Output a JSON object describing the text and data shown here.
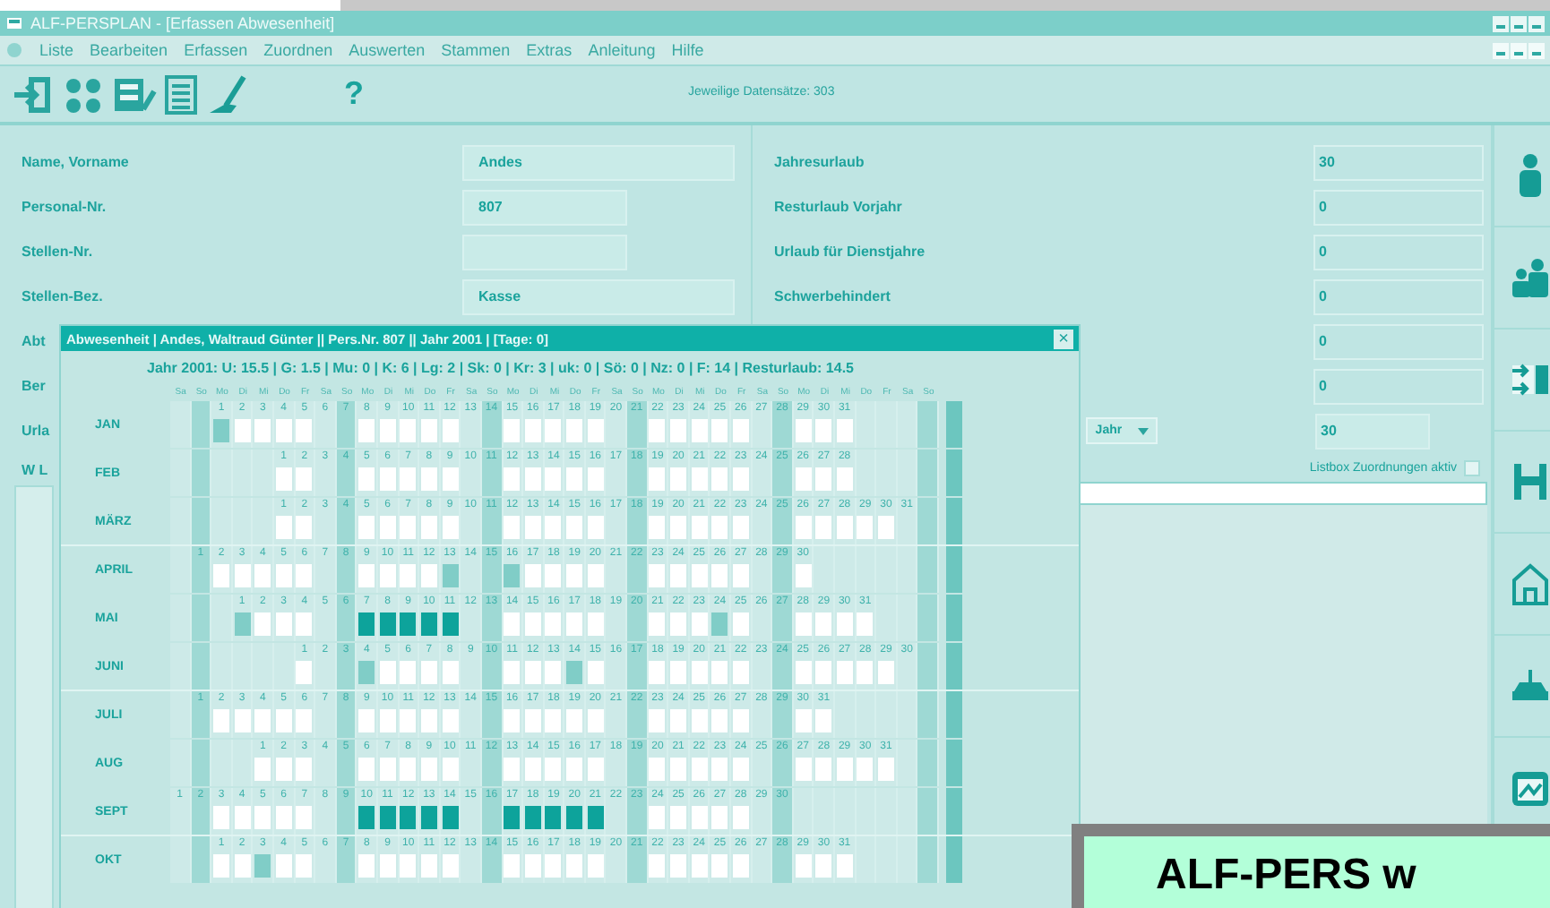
{
  "window": {
    "title": "ALF-PERSPLAN - [Erfassen Abwesenheit]"
  },
  "menu": [
    "Liste",
    "Bearbeiten",
    "Erfassen",
    "Zuordnen",
    "Auswerten",
    "Stammen",
    "Extras",
    "Anleitung",
    "Hilfe"
  ],
  "toolbar": {
    "help": "?",
    "record_count": "Jeweilige Datensätze: 303"
  },
  "person": [
    {
      "label": "Name, Vorname",
      "value": "Andes",
      "kind": "wide"
    },
    {
      "label": "Personal-Nr.",
      "value": "807",
      "kind": "narrow"
    },
    {
      "label": "Stellen-Nr.",
      "kind": "narrow"
    },
    {
      "label": "Stellen-Bez.",
      "value": "Kasse",
      "kind": "wide"
    },
    {
      "label": "Abt",
      "kind": "none"
    },
    {
      "label": "Ber",
      "kind": "none"
    },
    {
      "label": "Urla",
      "kind": "none"
    }
  ],
  "vacation": [
    {
      "label": "Jahresurlaub",
      "value": "30"
    },
    {
      "label": "Resturlaub Vorjahr",
      "value": "0"
    },
    {
      "label": "Urlaub für Dienstjahre",
      "value": "0"
    },
    {
      "label": "Schwerbehindert",
      "value": "0"
    },
    {
      "value": "0"
    },
    {
      "value": "0"
    }
  ],
  "year_select": {
    "value": "Jahr"
  },
  "year_value": "30",
  "listbox_toggle": {
    "label": "Listbox Zuordnungen aktiv",
    "checked": false
  },
  "left_list": {
    "header": "W L"
  },
  "dialog": {
    "title": "Abwesenheit | Andes, Waltraud Günter || Pers.Nr. 807 || Jahr 2001 | [Tage: 0]",
    "close": "×",
    "summary": "Jahr 2001: U: 15.5 | G: 1.5 | Mu: 0 | K: 6 | Lg: 2 | Sk: 0 | Kr: 3 | uk: 0 | Sö: 0 | Nz: 0 | F: 14 | Resturlaub: 14.5",
    "weekdays": [
      "Sa",
      "So",
      "Mo",
      "Di",
      "Mi",
      "Do",
      "Fr",
      "Sa",
      "So",
      "Mo",
      "Di",
      "Mi",
      "Do",
      "Fr",
      "Sa",
      "So",
      "Mo",
      "Di",
      "Mi",
      "Do",
      "Fr",
      "Sa",
      "So",
      "Mo",
      "Di",
      "Mi",
      "Do",
      "Fr",
      "Sa",
      "So",
      "Mo",
      "Di",
      "Mi",
      "Do",
      "Fr",
      "Sa",
      "So"
    ],
    "months": [
      {
        "label": "JAN",
        "cells": [
          {
            "kind": "blank"
          },
          {
            "kind": "blank"
          },
          {
            "day": "1",
            "kind": "holiday"
          },
          {
            "day": "2",
            "kind": "work"
          },
          {
            "day": "3",
            "kind": "work"
          },
          {
            "day": "4",
            "kind": "work"
          },
          {
            "day": "5",
            "kind": "work"
          },
          {
            "day": "6",
            "kind": "weekend"
          },
          {
            "day": "7",
            "kind": "weekend"
          },
          {
            "day": "8",
            "kind": "work"
          },
          {
            "day": "9",
            "kind": "work"
          },
          {
            "day": "10",
            "kind": "work"
          },
          {
            "day": "11",
            "kind": "work"
          },
          {
            "day": "12",
            "kind": "work"
          },
          {
            "day": "13",
            "kind": "weekend"
          },
          {
            "day": "14",
            "kind": "weekend"
          },
          {
            "day": "15",
            "kind": "work"
          },
          {
            "day": "16",
            "kind": "work"
          },
          {
            "day": "17",
            "kind": "work"
          },
          {
            "day": "18",
            "kind": "work"
          },
          {
            "day": "19",
            "kind": "work"
          },
          {
            "day": "20",
            "kind": "weekend"
          },
          {
            "day": "21",
            "kind": "weekend"
          },
          {
            "day": "22",
            "kind": "work"
          },
          {
            "day": "23",
            "kind": "work"
          },
          {
            "day": "24",
            "kind": "work"
          },
          {
            "day": "25",
            "kind": "work"
          },
          {
            "day": "26",
            "kind": "work"
          },
          {
            "day": "27",
            "kind": "weekend"
          },
          {
            "day": "28",
            "kind": "weekend"
          },
          {
            "day": "29",
            "kind": "work"
          },
          {
            "day": "30",
            "kind": "work"
          },
          {
            "day": "31",
            "kind": "work"
          }
        ]
      },
      {
        "label": "FEB",
        "cells": [
          {
            "kind": "blank"
          },
          {
            "kind": "blank"
          },
          {
            "kind": "blank"
          },
          {
            "kind": "blank"
          },
          {
            "kind": "blank"
          },
          {
            "day": "1",
            "kind": "work"
          },
          {
            "day": "2",
            "kind": "work"
          },
          {
            "day": "3",
            "kind": "weekend"
          },
          {
            "day": "4",
            "kind": "weekend"
          },
          {
            "day": "5",
            "kind": "work"
          },
          {
            "day": "6",
            "kind": "work"
          },
          {
            "day": "7",
            "kind": "work"
          },
          {
            "day": "8",
            "kind": "work"
          },
          {
            "day": "9",
            "kind": "work"
          },
          {
            "day": "10",
            "kind": "weekend"
          },
          {
            "day": "11",
            "kind": "weekend"
          },
          {
            "day": "12",
            "kind": "work"
          },
          {
            "day": "13",
            "kind": "work"
          },
          {
            "day": "14",
            "kind": "work"
          },
          {
            "day": "15",
            "kind": "work"
          },
          {
            "day": "16",
            "kind": "work"
          },
          {
            "day": "17",
            "kind": "weekend"
          },
          {
            "day": "18",
            "kind": "weekend"
          },
          {
            "day": "19",
            "kind": "work"
          },
          {
            "day": "20",
            "kind": "work"
          },
          {
            "day": "21",
            "kind": "work"
          },
          {
            "day": "22",
            "kind": "work"
          },
          {
            "day": "23",
            "kind": "work"
          },
          {
            "day": "24",
            "kind": "weekend"
          },
          {
            "day": "25",
            "kind": "weekend"
          },
          {
            "day": "26",
            "kind": "work"
          },
          {
            "day": "27",
            "kind": "work"
          },
          {
            "day": "28",
            "kind": "work"
          }
        ]
      },
      {
        "label": "MÄRZ",
        "cells": [
          {
            "kind": "blank"
          },
          {
            "kind": "blank"
          },
          {
            "kind": "blank"
          },
          {
            "kind": "blank"
          },
          {
            "kind": "blank"
          },
          {
            "day": "1",
            "kind": "work"
          },
          {
            "day": "2",
            "kind": "work"
          },
          {
            "day": "3",
            "kind": "weekend"
          },
          {
            "day": "4",
            "kind": "weekend"
          },
          {
            "day": "5",
            "kind": "work"
          },
          {
            "day": "6",
            "kind": "work"
          },
          {
            "day": "7",
            "kind": "work"
          },
          {
            "day": "8",
            "kind": "work"
          },
          {
            "day": "9",
            "kind": "work"
          },
          {
            "day": "10",
            "kind": "weekend"
          },
          {
            "day": "11",
            "kind": "weekend"
          },
          {
            "day": "12",
            "kind": "work"
          },
          {
            "day": "13",
            "kind": "work"
          },
          {
            "day": "14",
            "kind": "work"
          },
          {
            "day": "15",
            "kind": "work"
          },
          {
            "day": "16",
            "kind": "work"
          },
          {
            "day": "17",
            "kind": "weekend"
          },
          {
            "day": "18",
            "kind": "weekend"
          },
          {
            "day": "19",
            "kind": "work"
          },
          {
            "day": "20",
            "kind": "work"
          },
          {
            "day": "21",
            "kind": "work"
          },
          {
            "day": "22",
            "kind": "work"
          },
          {
            "day": "23",
            "kind": "work"
          },
          {
            "day": "24",
            "kind": "weekend"
          },
          {
            "day": "25",
            "kind": "weekend"
          },
          {
            "day": "26",
            "kind": "work"
          },
          {
            "day": "27",
            "kind": "work"
          },
          {
            "day": "28",
            "kind": "work"
          },
          {
            "day": "29",
            "kind": "work"
          },
          {
            "day": "30",
            "kind": "work"
          },
          {
            "day": "31",
            "kind": "weekend"
          }
        ]
      },
      {
        "label": "APRIL",
        "cells": [
          {
            "kind": "blank"
          },
          {
            "day": "1",
            "kind": "weekend"
          },
          {
            "day": "2",
            "kind": "work"
          },
          {
            "day": "3",
            "kind": "work"
          },
          {
            "day": "4",
            "kind": "work"
          },
          {
            "day": "5",
            "kind": "work"
          },
          {
            "day": "6",
            "kind": "work"
          },
          {
            "day": "7",
            "kind": "weekend"
          },
          {
            "day": "8",
            "kind": "weekend"
          },
          {
            "day": "9",
            "kind": "work"
          },
          {
            "day": "10",
            "kind": "work"
          },
          {
            "day": "11",
            "kind": "work"
          },
          {
            "day": "12",
            "kind": "work"
          },
          {
            "day": "13",
            "kind": "holiday"
          },
          {
            "day": "14",
            "kind": "weekend"
          },
          {
            "day": "15",
            "kind": "weekend"
          },
          {
            "day": "16",
            "kind": "holiday"
          },
          {
            "day": "17",
            "kind": "work"
          },
          {
            "day": "18",
            "kind": "work"
          },
          {
            "day": "19",
            "kind": "work"
          },
          {
            "day": "20",
            "kind": "work"
          },
          {
            "day": "21",
            "kind": "weekend"
          },
          {
            "day": "22",
            "kind": "weekend"
          },
          {
            "day": "23",
            "kind": "work"
          },
          {
            "day": "24",
            "kind": "work"
          },
          {
            "day": "25",
            "kind": "work"
          },
          {
            "day": "26",
            "kind": "work"
          },
          {
            "day": "27",
            "kind": "work"
          },
          {
            "day": "28",
            "kind": "weekend"
          },
          {
            "day": "29",
            "kind": "weekend"
          },
          {
            "day": "30",
            "kind": "work"
          }
        ]
      },
      {
        "label": "MAI",
        "cells": [
          {
            "kind": "blank"
          },
          {
            "kind": "blank"
          },
          {
            "kind": "blank"
          },
          {
            "day": "1",
            "kind": "holiday"
          },
          {
            "day": "2",
            "kind": "work"
          },
          {
            "day": "3",
            "kind": "work"
          },
          {
            "day": "4",
            "kind": "work"
          },
          {
            "day": "5",
            "kind": "weekend"
          },
          {
            "day": "6",
            "kind": "weekend"
          },
          {
            "day": "7",
            "kind": "absence"
          },
          {
            "day": "8",
            "kind": "absence"
          },
          {
            "day": "9",
            "kind": "absence"
          },
          {
            "day": "10",
            "kind": "absence"
          },
          {
            "day": "11",
            "kind": "absence"
          },
          {
            "day": "12",
            "kind": "weekend"
          },
          {
            "day": "13",
            "kind": "weekend"
          },
          {
            "day": "14",
            "kind": "work"
          },
          {
            "day": "15",
            "kind": "work"
          },
          {
            "day": "16",
            "kind": "work"
          },
          {
            "day": "17",
            "kind": "work"
          },
          {
            "day": "18",
            "kind": "work"
          },
          {
            "day": "19",
            "kind": "weekend"
          },
          {
            "day": "20",
            "kind": "weekend"
          },
          {
            "day": "21",
            "kind": "work"
          },
          {
            "day": "22",
            "kind": "work"
          },
          {
            "day": "23",
            "kind": "work"
          },
          {
            "day": "24",
            "kind": "holiday"
          },
          {
            "day": "25",
            "kind": "work"
          },
          {
            "day": "26",
            "kind": "weekend"
          },
          {
            "day": "27",
            "kind": "weekend"
          },
          {
            "day": "28",
            "kind": "work"
          },
          {
            "day": "29",
            "kind": "work"
          },
          {
            "day": "30",
            "kind": "work"
          },
          {
            "day": "31",
            "kind": "work"
          }
        ]
      },
      {
        "label": "JUNI",
        "cells": [
          {
            "kind": "blank"
          },
          {
            "kind": "blank"
          },
          {
            "kind": "blank"
          },
          {
            "kind": "blank"
          },
          {
            "kind": "blank"
          },
          {
            "kind": "blank"
          },
          {
            "day": "1",
            "kind": "work"
          },
          {
            "day": "2",
            "kind": "weekend"
          },
          {
            "day": "3",
            "kind": "weekend"
          },
          {
            "day": "4",
            "kind": "holiday"
          },
          {
            "day": "5",
            "kind": "work"
          },
          {
            "day": "6",
            "kind": "work"
          },
          {
            "day": "7",
            "kind": "work"
          },
          {
            "day": "8",
            "kind": "work"
          },
          {
            "day": "9",
            "kind": "weekend"
          },
          {
            "day": "10",
            "kind": "weekend"
          },
          {
            "day": "11",
            "kind": "work"
          },
          {
            "day": "12",
            "kind": "work"
          },
          {
            "day": "13",
            "kind": "work"
          },
          {
            "day": "14",
            "kind": "holiday"
          },
          {
            "day": "15",
            "kind": "work"
          },
          {
            "day": "16",
            "kind": "weekend"
          },
          {
            "day": "17",
            "kind": "weekend"
          },
          {
            "day": "18",
            "kind": "work"
          },
          {
            "day": "19",
            "kind": "work"
          },
          {
            "day": "20",
            "kind": "work"
          },
          {
            "day": "21",
            "kind": "work"
          },
          {
            "day": "22",
            "kind": "work"
          },
          {
            "day": "23",
            "kind": "weekend"
          },
          {
            "day": "24",
            "kind": "weekend"
          },
          {
            "day": "25",
            "kind": "work"
          },
          {
            "day": "26",
            "kind": "work"
          },
          {
            "day": "27",
            "kind": "work"
          },
          {
            "day": "28",
            "kind": "work"
          },
          {
            "day": "29",
            "kind": "work"
          },
          {
            "day": "30",
            "kind": "weekend"
          }
        ]
      },
      {
        "label": "JULI",
        "cells": [
          {
            "kind": "blank"
          },
          {
            "day": "1",
            "kind": "weekend"
          },
          {
            "day": "2",
            "kind": "work"
          },
          {
            "day": "3",
            "kind": "work"
          },
          {
            "day": "4",
            "kind": "work"
          },
          {
            "day": "5",
            "kind": "work"
          },
          {
            "day": "6",
            "kind": "work"
          },
          {
            "day": "7",
            "kind": "weekend"
          },
          {
            "day": "8",
            "kind": "weekend"
          },
          {
            "day": "9",
            "kind": "work"
          },
          {
            "day": "10",
            "kind": "work"
          },
          {
            "day": "11",
            "kind": "work"
          },
          {
            "day": "12",
            "kind": "work"
          },
          {
            "day": "13",
            "kind": "work"
          },
          {
            "day": "14",
            "kind": "weekend"
          },
          {
            "day": "15",
            "kind": "weekend"
          },
          {
            "day": "16",
            "kind": "work"
          },
          {
            "day": "17",
            "kind": "work"
          },
          {
            "day": "18",
            "kind": "work"
          },
          {
            "day": "19",
            "kind": "work"
          },
          {
            "day": "20",
            "kind": "work"
          },
          {
            "day": "21",
            "kind": "weekend"
          },
          {
            "day": "22",
            "kind": "weekend"
          },
          {
            "day": "23",
            "kind": "work"
          },
          {
            "day": "24",
            "kind": "work"
          },
          {
            "day": "25",
            "kind": "work"
          },
          {
            "day": "26",
            "kind": "work"
          },
          {
            "day": "27",
            "kind": "work"
          },
          {
            "day": "28",
            "kind": "weekend"
          },
          {
            "day": "29",
            "kind": "weekend"
          },
          {
            "day": "30",
            "kind": "work"
          },
          {
            "day": "31",
            "kind": "work"
          }
        ]
      },
      {
        "label": "AUG",
        "cells": [
          {
            "kind": "blank"
          },
          {
            "kind": "blank"
          },
          {
            "kind": "blank"
          },
          {
            "kind": "blank"
          },
          {
            "day": "1",
            "kind": "work"
          },
          {
            "day": "2",
            "kind": "work"
          },
          {
            "day": "3",
            "kind": "work"
          },
          {
            "day": "4",
            "kind": "weekend"
          },
          {
            "day": "5",
            "kind": "weekend"
          },
          {
            "day": "6",
            "kind": "work"
          },
          {
            "day": "7",
            "kind": "work"
          },
          {
            "day": "8",
            "kind": "work"
          },
          {
            "day": "9",
            "kind": "work"
          },
          {
            "day": "10",
            "kind": "work"
          },
          {
            "day": "11",
            "kind": "weekend"
          },
          {
            "day": "12",
            "kind": "weekend"
          },
          {
            "day": "13",
            "kind": "work"
          },
          {
            "day": "14",
            "kind": "work"
          },
          {
            "day": "15",
            "kind": "work"
          },
          {
            "day": "16",
            "kind": "work"
          },
          {
            "day": "17",
            "kind": "work"
          },
          {
            "day": "18",
            "kind": "weekend"
          },
          {
            "day": "19",
            "kind": "weekend"
          },
          {
            "day": "20",
            "kind": "work"
          },
          {
            "day": "21",
            "kind": "work"
          },
          {
            "day": "22",
            "kind": "work"
          },
          {
            "day": "23",
            "kind": "work"
          },
          {
            "day": "24",
            "kind": "work"
          },
          {
            "day": "25",
            "kind": "weekend"
          },
          {
            "day": "26",
            "kind": "weekend"
          },
          {
            "day": "27",
            "kind": "work"
          },
          {
            "day": "28",
            "kind": "work"
          },
          {
            "day": "29",
            "kind": "work"
          },
          {
            "day": "30",
            "kind": "work"
          },
          {
            "day": "31",
            "kind": "work"
          }
        ]
      },
      {
        "label": "SEPT",
        "cells": [
          {
            "day": "1",
            "kind": "weekend"
          },
          {
            "day": "2",
            "kind": "weekend"
          },
          {
            "day": "3",
            "kind": "work"
          },
          {
            "day": "4",
            "kind": "work"
          },
          {
            "day": "5",
            "kind": "work"
          },
          {
            "day": "6",
            "kind": "work"
          },
          {
            "day": "7",
            "kind": "work"
          },
          {
            "day": "8",
            "kind": "weekend"
          },
          {
            "day": "9",
            "kind": "weekend"
          },
          {
            "day": "10",
            "kind": "absence"
          },
          {
            "day": "11",
            "kind": "absence"
          },
          {
            "day": "12",
            "kind": "absence"
          },
          {
            "day": "13",
            "kind": "absence"
          },
          {
            "day": "14",
            "kind": "absence"
          },
          {
            "day": "15",
            "kind": "weekend"
          },
          {
            "day": "16",
            "kind": "weekend"
          },
          {
            "day": "17",
            "kind": "absence"
          },
          {
            "day": "18",
            "kind": "absence"
          },
          {
            "day": "19",
            "kind": "absence"
          },
          {
            "day": "20",
            "kind": "absence"
          },
          {
            "day": "21",
            "kind": "absence"
          },
          {
            "day": "22",
            "kind": "weekend"
          },
          {
            "day": "23",
            "kind": "weekend"
          },
          {
            "day": "24",
            "kind": "work"
          },
          {
            "day": "25",
            "kind": "work"
          },
          {
            "day": "26",
            "kind": "work"
          },
          {
            "day": "27",
            "kind": "work"
          },
          {
            "day": "28",
            "kind": "work"
          },
          {
            "day": "29",
            "kind": "weekend"
          },
          {
            "day": "30",
            "kind": "weekend"
          }
        ]
      },
      {
        "label": "OKT",
        "cells": [
          {
            "kind": "blank"
          },
          {
            "kind": "blank"
          },
          {
            "day": "1",
            "kind": "work"
          },
          {
            "day": "2",
            "kind": "work"
          },
          {
            "day": "3",
            "kind": "holiday"
          },
          {
            "day": "4",
            "kind": "work"
          },
          {
            "day": "5",
            "kind": "work"
          },
          {
            "day": "6",
            "kind": "weekend"
          },
          {
            "day": "7",
            "kind": "weekend"
          },
          {
            "day": "8",
            "kind": "work"
          },
          {
            "day": "9",
            "kind": "work"
          },
          {
            "day": "10",
            "kind": "work"
          },
          {
            "day": "11",
            "kind": "work"
          },
          {
            "day": "12",
            "kind": "work"
          },
          {
            "day": "13",
            "kind": "weekend"
          },
          {
            "day": "14",
            "kind": "weekend"
          },
          {
            "day": "15",
            "kind": "work"
          },
          {
            "day": "16",
            "kind": "work"
          },
          {
            "day": "17",
            "kind": "work"
          },
          {
            "day": "18",
            "kind": "work"
          },
          {
            "day": "19",
            "kind": "work"
          },
          {
            "day": "20",
            "kind": "weekend"
          },
          {
            "day": "21",
            "kind": "weekend"
          },
          {
            "day": "22",
            "kind": "work"
          },
          {
            "day": "23",
            "kind": "work"
          },
          {
            "day": "24",
            "kind": "work"
          },
          {
            "day": "25",
            "kind": "work"
          },
          {
            "day": "26",
            "kind": "work"
          },
          {
            "day": "27",
            "kind": "weekend"
          },
          {
            "day": "28",
            "kind": "weekend"
          },
          {
            "day": "29",
            "kind": "work"
          },
          {
            "day": "30",
            "kind": "work"
          },
          {
            "day": "31",
            "kind": "work"
          }
        ]
      }
    ]
  },
  "caption": "ALF-PERS w"
}
